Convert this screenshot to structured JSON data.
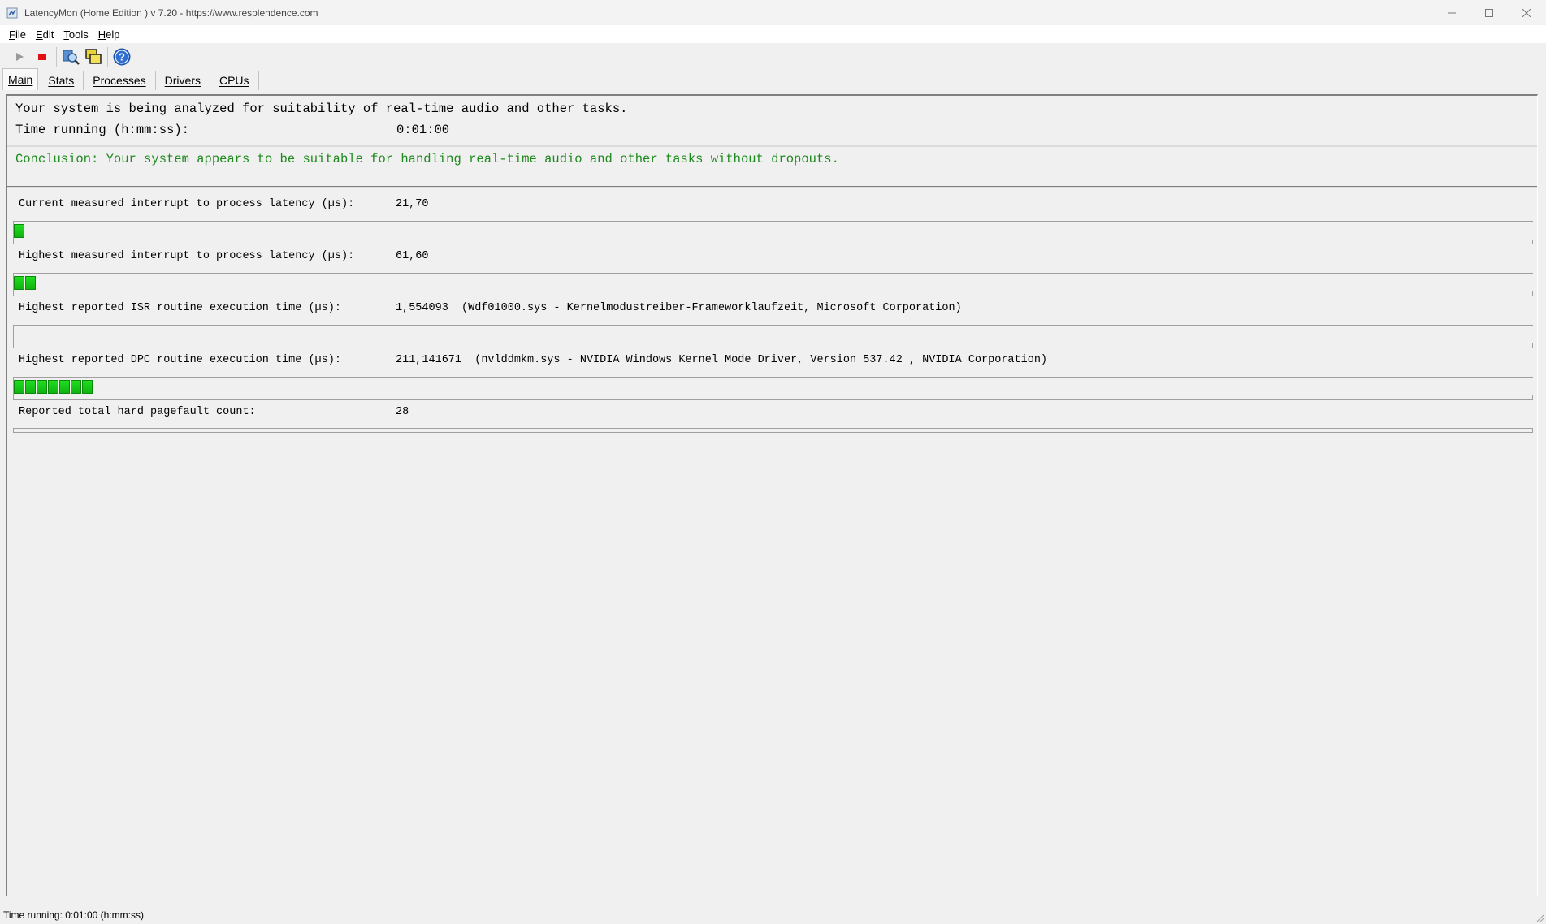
{
  "window": {
    "title": "LatencyMon  (Home Edition )  v 7.20 - https://www.resplendence.com"
  },
  "menu": {
    "items": [
      {
        "key": "F",
        "rest": "ile"
      },
      {
        "key": "E",
        "rest": "dit"
      },
      {
        "key": "T",
        "rest": "ools"
      },
      {
        "key": "H",
        "rest": "elp"
      }
    ]
  },
  "toolbar": {
    "icons": [
      "play-icon",
      "stop-icon",
      "driver-inspect-icon",
      "windows-icon",
      "help-icon"
    ]
  },
  "tabs": [
    {
      "label": "Main",
      "active": true
    },
    {
      "label": "Stats",
      "active": false
    },
    {
      "label": "Processes",
      "active": false
    },
    {
      "label": "Drivers",
      "active": false
    },
    {
      "label": "CPUs",
      "active": false
    }
  ],
  "main": {
    "analysis_line": "Your system is being analyzed for suitability of real-time audio and other tasks.",
    "time_running_label": "Time running (h:mm:ss):",
    "time_running_value": "0:01:00",
    "conclusion": "Conclusion: Your system appears to be suitable for handling real-time audio and other tasks without dropouts.",
    "conclusion_color": "#1e8a1e",
    "metrics": [
      {
        "label": "Current measured interrupt to process latency (µs):",
        "value": "21,70",
        "segments": 1
      },
      {
        "label": "Highest measured interrupt to process latency (µs):",
        "value": "61,60",
        "segments": 2
      },
      {
        "label": "Highest reported ISR routine execution time (µs):",
        "value": "1,554093  (Wdf01000.sys - Kernelmodustreiber-Frameworklaufzeit, Microsoft Corporation)",
        "segments": 0
      },
      {
        "label": "Highest reported DPC routine execution time (µs):",
        "value": "211,141671  (nvlddmkm.sys - NVIDIA Windows Kernel Mode Driver, Version 537.42 , NVIDIA Corporation)",
        "segments": 7
      },
      {
        "label": "Reported total hard pagefault count:",
        "value": "28"
      }
    ]
  },
  "statusbar": {
    "text": "Time running: 0:01:00  (h:mm:ss)"
  },
  "colors": {
    "meter_green": "#18c818",
    "stop_red": "#e01010"
  }
}
